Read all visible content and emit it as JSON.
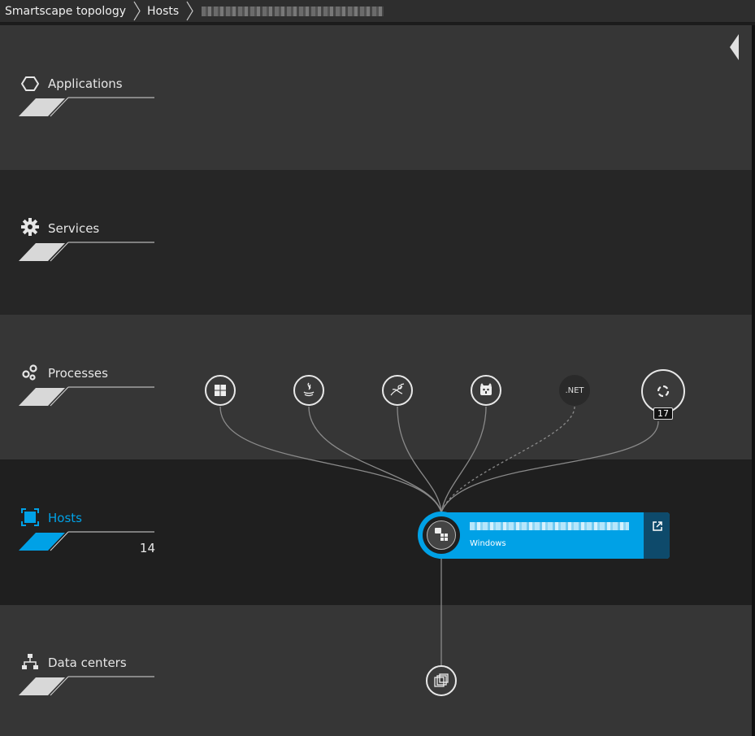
{
  "breadcrumb": {
    "items": [
      "Smartscape topology",
      "Hosts"
    ]
  },
  "layers": {
    "applications": {
      "label": "Applications",
      "icon": "hexagon-icon"
    },
    "services": {
      "label": "Services",
      "icon": "gear-icon"
    },
    "processes": {
      "label": "Processes",
      "icon": "processes-icon"
    },
    "hosts": {
      "label": "Hosts",
      "icon": "host-icon",
      "count": "14",
      "active": true,
      "accent": "#00a1e6"
    },
    "datacenters": {
      "label": "Data centers",
      "icon": "network-tree-icon"
    }
  },
  "processes": {
    "nodes": [
      {
        "icon": "windows-icon"
      },
      {
        "icon": "java-icon"
      },
      {
        "icon": "bug-process-icon"
      },
      {
        "icon": "tomcat-icon"
      },
      {
        "icon": "dotnet-icon",
        "label": ".NET"
      },
      {
        "icon": "process-group-icon",
        "badge": "17"
      }
    ]
  },
  "host_card": {
    "os": "Windows",
    "color": "#00a1e6"
  }
}
